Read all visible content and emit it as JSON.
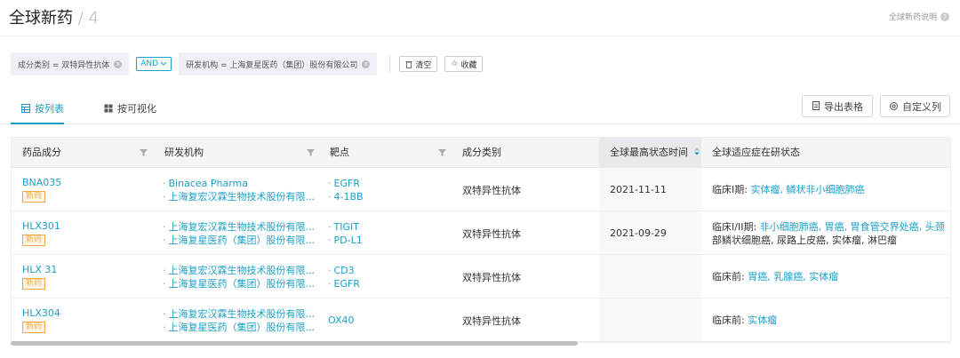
{
  "header": {
    "title": "全球新药",
    "count": "/ 4",
    "help": "全球新药说明"
  },
  "filters": {
    "chip1": "成分类别 = 双特异性抗体",
    "and": "AND",
    "chip2": "研发机构 = 上海复星医药（集团）股份有限公司",
    "clear": "清空",
    "favorite": "收藏"
  },
  "tabs": {
    "list": "按列表",
    "viz": "按可视化",
    "export": "导出表格",
    "custom": "自定义列"
  },
  "columns": [
    "药品成分",
    "研发机构",
    "靶点",
    "成分类别",
    "全球最高状态时间",
    "全球适应症在研状态"
  ],
  "rows": [
    {
      "drug": "BNA035",
      "badge": "新药",
      "orgs": [
        "Binacea Pharma",
        "上海复宏汉霖生物技术股份有限..."
      ],
      "targets": [
        "EGFR",
        "4-1BB"
      ],
      "category": "双特异性抗体",
      "date": "2021-11-11",
      "status_prefix": "临床I期:",
      "indications": "实体瘤, 鳞状非小细胞肺癌",
      "indications2": ""
    },
    {
      "drug": "HLX301",
      "badge": "新药",
      "orgs": [
        "上海复宏汉霖生物技术股份有限...",
        "上海复星医药（集团）股份有限..."
      ],
      "targets": [
        "TIGIT",
        "PD-L1"
      ],
      "category": "双特异性抗体",
      "date": "2021-09-29",
      "status_prefix": "临床I/II期:",
      "indications": "非小细胞肺癌, 胃癌, 胃食管交界处癌, 头颈",
      "indications2": "部鳞状细胞癌, 尿路上皮癌, 实体瘤, 淋巴瘤"
    },
    {
      "drug": "HLX 31",
      "badge": "新药",
      "orgs": [
        "上海复宏汉霖生物技术股份有限...",
        "上海复星医药（集团）股份有限..."
      ],
      "targets": [
        "CD3",
        "EGFR"
      ],
      "category": "双特异性抗体",
      "date": "",
      "status_prefix": "临床前:",
      "indications": "胃癌, 乳腺癌, 实体瘤",
      "indications2": ""
    },
    {
      "drug": "HLX304",
      "badge": "新药",
      "orgs": [
        "上海复宏汉霖生物技术股份有限...",
        "上海复星医药（集团）股份有限..."
      ],
      "targets": [
        "OX40"
      ],
      "category": "双特异性抗体",
      "date": "",
      "status_prefix": "临床前:",
      "indications": "实体瘤",
      "indications2": ""
    }
  ],
  "colors": {
    "accent": "#1aa0c8",
    "badge": "#f0a94a"
  }
}
